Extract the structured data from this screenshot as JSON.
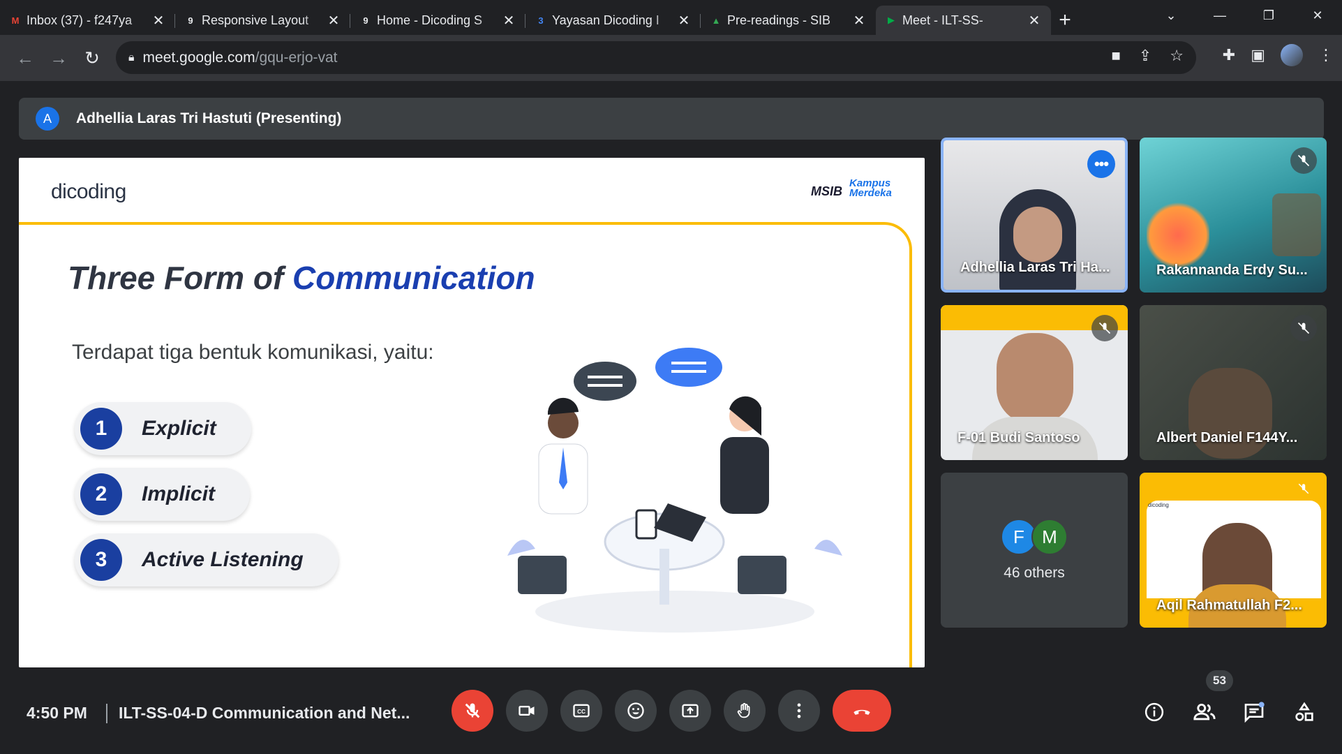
{
  "browser": {
    "tabs": [
      {
        "title": "Inbox (37) - f247ya",
        "favicon": "gmail-icon",
        "fav_color": "#ea4335",
        "fav_text": "M"
      },
      {
        "title": "Responsive Layout",
        "favicon": "dicoding-icon",
        "fav_color": "#e8eaed",
        "fav_text": "9"
      },
      {
        "title": "Home - Dicoding S",
        "favicon": "dicoding-icon",
        "fav_color": "#e8eaed",
        "fav_text": "9"
      },
      {
        "title": "Yayasan Dicoding I",
        "favicon": "calendar-icon",
        "fav_color": "#4285f4",
        "fav_text": "3"
      },
      {
        "title": "Pre-readings - SIB",
        "favicon": "drive-icon",
        "fav_color": "#34a853",
        "fav_text": "▲"
      },
      {
        "title": "Meet - ILT-SS-",
        "favicon": "meet-icon",
        "fav_color": "#00ac47",
        "fav_text": "▶",
        "active": true
      }
    ],
    "url_host": "meet.google.com",
    "url_path": "/gqu-erjo-vat"
  },
  "presenter": {
    "initial": "A",
    "label": "Adhellia Laras Tri Hastuti (Presenting)"
  },
  "slide": {
    "brand": "dicoding",
    "msib": "MSIB",
    "kampus": "Kampus Merdeka",
    "title_part1": "Three Form of ",
    "title_part2": "Communication",
    "intro": "Terdapat tiga bentuk komunikasi, yaitu:",
    "items": [
      {
        "num": "1",
        "label": "Explicit"
      },
      {
        "num": "2",
        "label": "Implicit"
      },
      {
        "num": "3",
        "label": "Active Listening"
      }
    ]
  },
  "participants": [
    {
      "name": "Adhellia Laras Tri Ha...",
      "speaking": true
    },
    {
      "name": "Rakannanda Erdy Su...",
      "muted": true
    },
    {
      "name": "F-01 Budi Santoso",
      "muted": true
    },
    {
      "name": "Albert Daniel F144Y...",
      "muted": true
    },
    {
      "name": "Aqil Rahmatullah F2...",
      "muted": true
    }
  ],
  "others": {
    "initials": [
      "F",
      "M"
    ],
    "colors": [
      "#1e88e5",
      "#2e7d32"
    ],
    "label": "46 others"
  },
  "bottom": {
    "time": "4:50 PM",
    "meeting": "ILT-SS-04-D Communication and Net...",
    "people_count": "53"
  }
}
